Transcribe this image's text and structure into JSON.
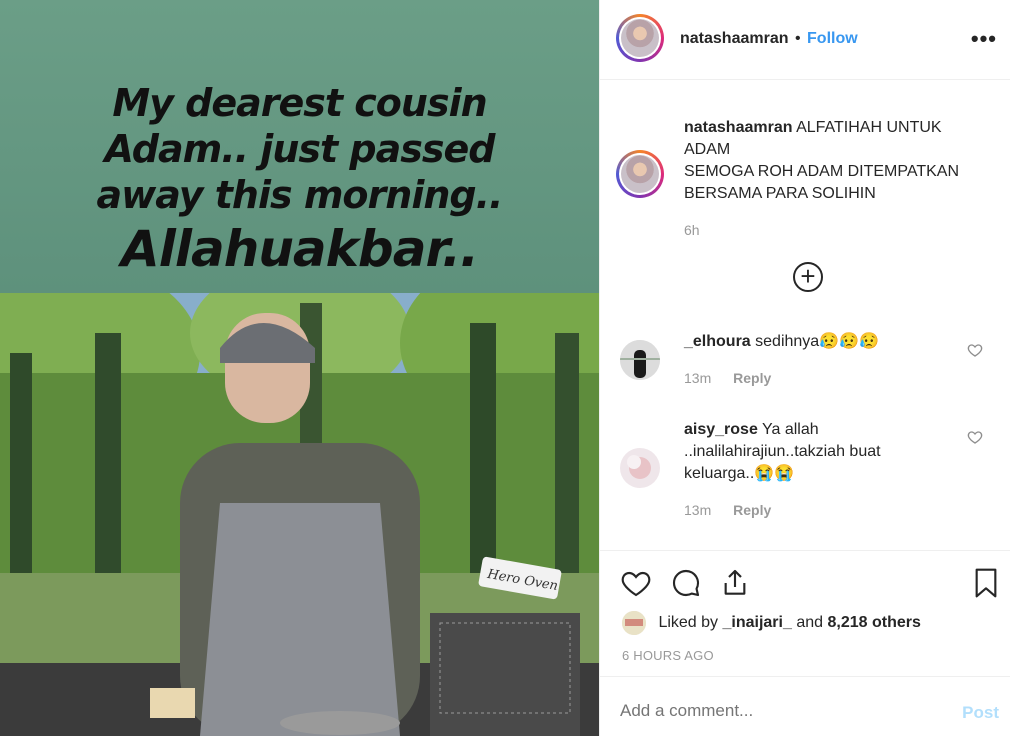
{
  "media": {
    "caption_lines": "My dearest cousin\nAdam.. just passed\naway this morning..",
    "caption_last": "Allahuakbar..",
    "sign_text": "Hero Oven"
  },
  "header": {
    "username": "natashaamran",
    "separator": "•",
    "follow_label": "Follow",
    "more_icon": "more-horizontal-icon"
  },
  "caption": {
    "username": "natashaamran",
    "text": "ALFATIHAH UNTUK ADAM\nSEMOGA ROH ADAM DITEMPATKAN BERSAMA PARA SOLIHIN",
    "time": "6h"
  },
  "load_more_icon": "plus-circle-icon",
  "comments": [
    {
      "username": "_elhoura",
      "text": "sedihnya😥😥😥",
      "time": "13m",
      "reply_label": "Reply"
    },
    {
      "username": "aisy_rose",
      "text": "Ya allah ..inalilahirajiun..takziah buat keluarga..😭😭",
      "time": "13m",
      "reply_label": "Reply"
    }
  ],
  "actions": {
    "like_icon": "heart-icon",
    "comment_icon": "comment-icon",
    "share_icon": "share-icon",
    "save_icon": "bookmark-icon"
  },
  "likes": {
    "prefix": "Liked by",
    "user": "_inaijari_",
    "middle": "and",
    "others": "8,218 others"
  },
  "timestamp": "6 HOURS AGO",
  "add_comment": {
    "placeholder": "Add a comment...",
    "post_label": "Post"
  },
  "colors": {
    "accent": "#3897f0",
    "post_disabled": "#b2dffc",
    "muted": "#999999"
  }
}
